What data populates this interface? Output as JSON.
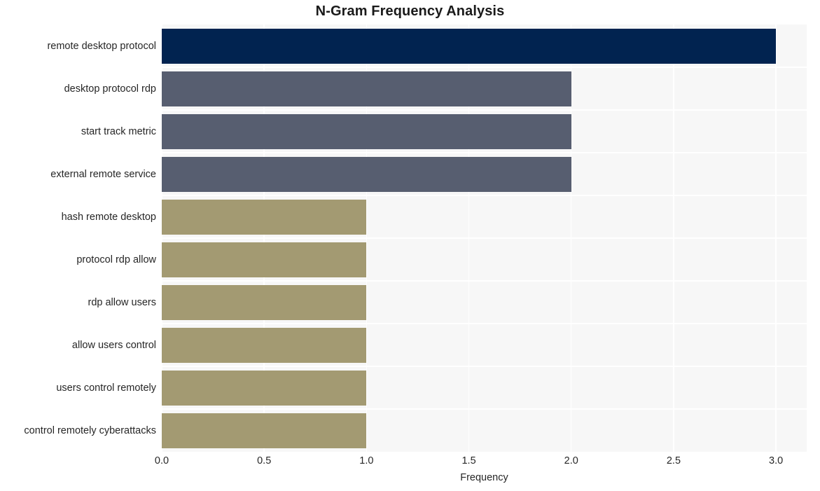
{
  "chart_data": {
    "type": "bar",
    "orientation": "horizontal",
    "title": "N-Gram Frequency Analysis",
    "xlabel": "Frequency",
    "ylabel": "",
    "xlim": [
      0,
      3.15
    ],
    "xticks": [
      0,
      0.5,
      1,
      1.5,
      2,
      2.5,
      3
    ],
    "xtick_labels": [
      "0.0",
      "0.5",
      "1.0",
      "1.5",
      "2.0",
      "2.5",
      "3.0"
    ],
    "grid": true,
    "legend": "none",
    "categories": [
      "remote desktop protocol",
      "desktop protocol rdp",
      "start track metric",
      "external remote service",
      "hash remote desktop",
      "protocol rdp allow",
      "rdp allow users",
      "allow users control",
      "users control remotely",
      "control remotely cyberattacks"
    ],
    "values": [
      3,
      2,
      2,
      2,
      1,
      1,
      1,
      1,
      1,
      1
    ],
    "bar_colors": [
      "#012350",
      "#575e70",
      "#575e70",
      "#575e70",
      "#a39a72",
      "#a39a72",
      "#a39a72",
      "#a39a72",
      "#a39a72",
      "#a39a72"
    ],
    "plot_background": "#f7f7f7",
    "grid_color": "#ffffff",
    "figure_background": "#ffffff",
    "text_color": "#262626"
  }
}
